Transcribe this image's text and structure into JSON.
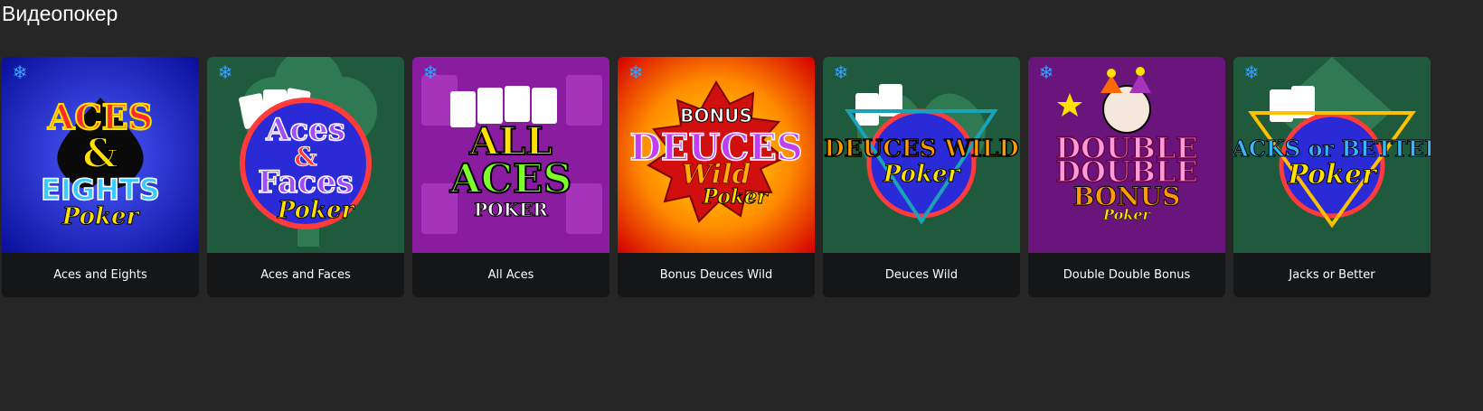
{
  "section": {
    "title": "Видеопокер"
  },
  "games": [
    {
      "name": "Aces and Eights",
      "logo_lines": [
        "ACES",
        "&",
        "EIGHTS",
        "Poker"
      ],
      "bg": "#1a21e0",
      "bg2": "#0a0f9a",
      "accent": "#ffe100"
    },
    {
      "name": "Aces and Faces",
      "logo_lines": [
        "Aces",
        "&",
        "Faces",
        "Poker"
      ],
      "bg": "#2a6b48",
      "bg2": "#183e2c",
      "accent": "#7a38ff"
    },
    {
      "name": "All Aces",
      "logo_lines": [
        "ALL",
        "ACES",
        "POKER"
      ],
      "bg": "#a11fb5",
      "bg2": "#6a137a",
      "accent": "#ffe100"
    },
    {
      "name": "Bonus Deuces Wild",
      "logo_lines": [
        "BONUS",
        "DEUCES",
        "Wild",
        "Poker"
      ],
      "bg": "#ff8a00",
      "bg2": "#e10d00",
      "accent": "#b12fd6"
    },
    {
      "name": "Deuces Wild",
      "logo_lines": [
        "DEUCES WILD",
        "Poker"
      ],
      "bg": "#2a6b48",
      "bg2": "#183e2c",
      "accent": "#ff9b00"
    },
    {
      "name": "Double Double Bonus",
      "logo_lines": [
        "DOUBLE",
        "DOUBLE",
        "BONUS",
        "Poker"
      ],
      "bg": "#7a1d8c",
      "bg2": "#4d0f5c",
      "accent": "#ff9bd6"
    },
    {
      "name": "Jacks or Better",
      "logo_lines": [
        "JACKS or BETTER",
        "Poker"
      ],
      "bg": "#2a6b48",
      "bg2": "#183e2c",
      "accent": "#38b6ff"
    }
  ],
  "icons": {
    "favorite": "snowflake-icon"
  },
  "colors": {
    "page_bg": "#262626",
    "card_caption_bg": "#151617",
    "icon_blue": "#3aa0ff"
  }
}
